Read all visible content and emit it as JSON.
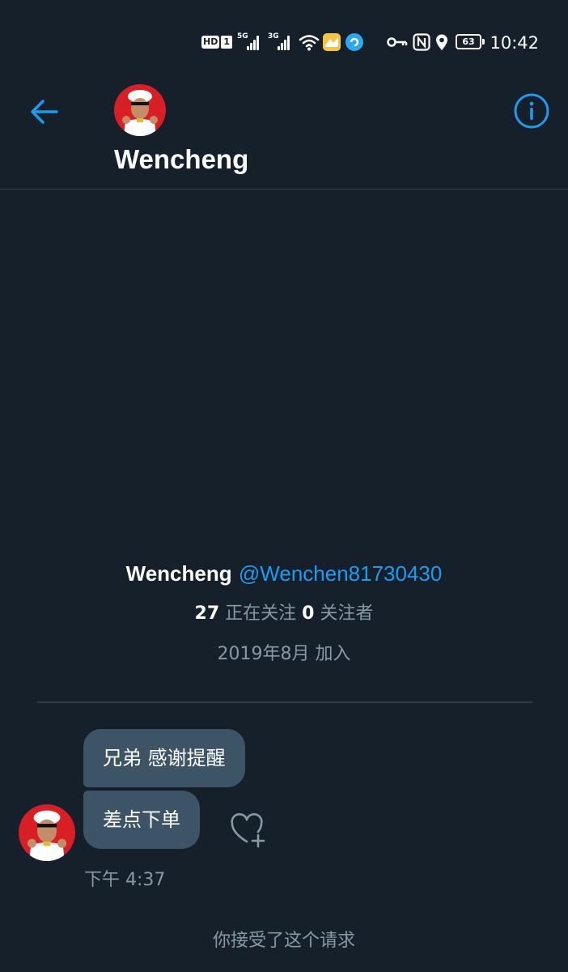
{
  "status_bar": {
    "hd_label": "HD",
    "sim_label": "1",
    "network_1": "5G",
    "network_2": "3G",
    "battery_level": "63",
    "time": "10:42",
    "icons": [
      "wifi-icon",
      "weather-icon",
      "app-icon",
      "key-icon",
      "nfc-icon",
      "location-icon"
    ]
  },
  "header": {
    "title": "Wencheng",
    "icons": [
      "back-arrow-icon",
      "info-icon"
    ]
  },
  "profile": {
    "name": "Wencheng",
    "handle": "@Wenchen81730430",
    "following_count": "27",
    "following_label": "正在关注",
    "followers_count": "0",
    "followers_label": "关注者",
    "joined": "2019年8月 加入"
  },
  "messages": [
    {
      "text": "兄弟 感谢提醒"
    },
    {
      "text": "差点下单"
    }
  ],
  "message_time": "下午 4:37",
  "request_note": "你接受了这个请求",
  "colors": {
    "background": "#15202b",
    "accent": "#1d9bf0",
    "bubble": "#3d5466",
    "muted_text": "#8899a6",
    "divider": "#38444d"
  }
}
